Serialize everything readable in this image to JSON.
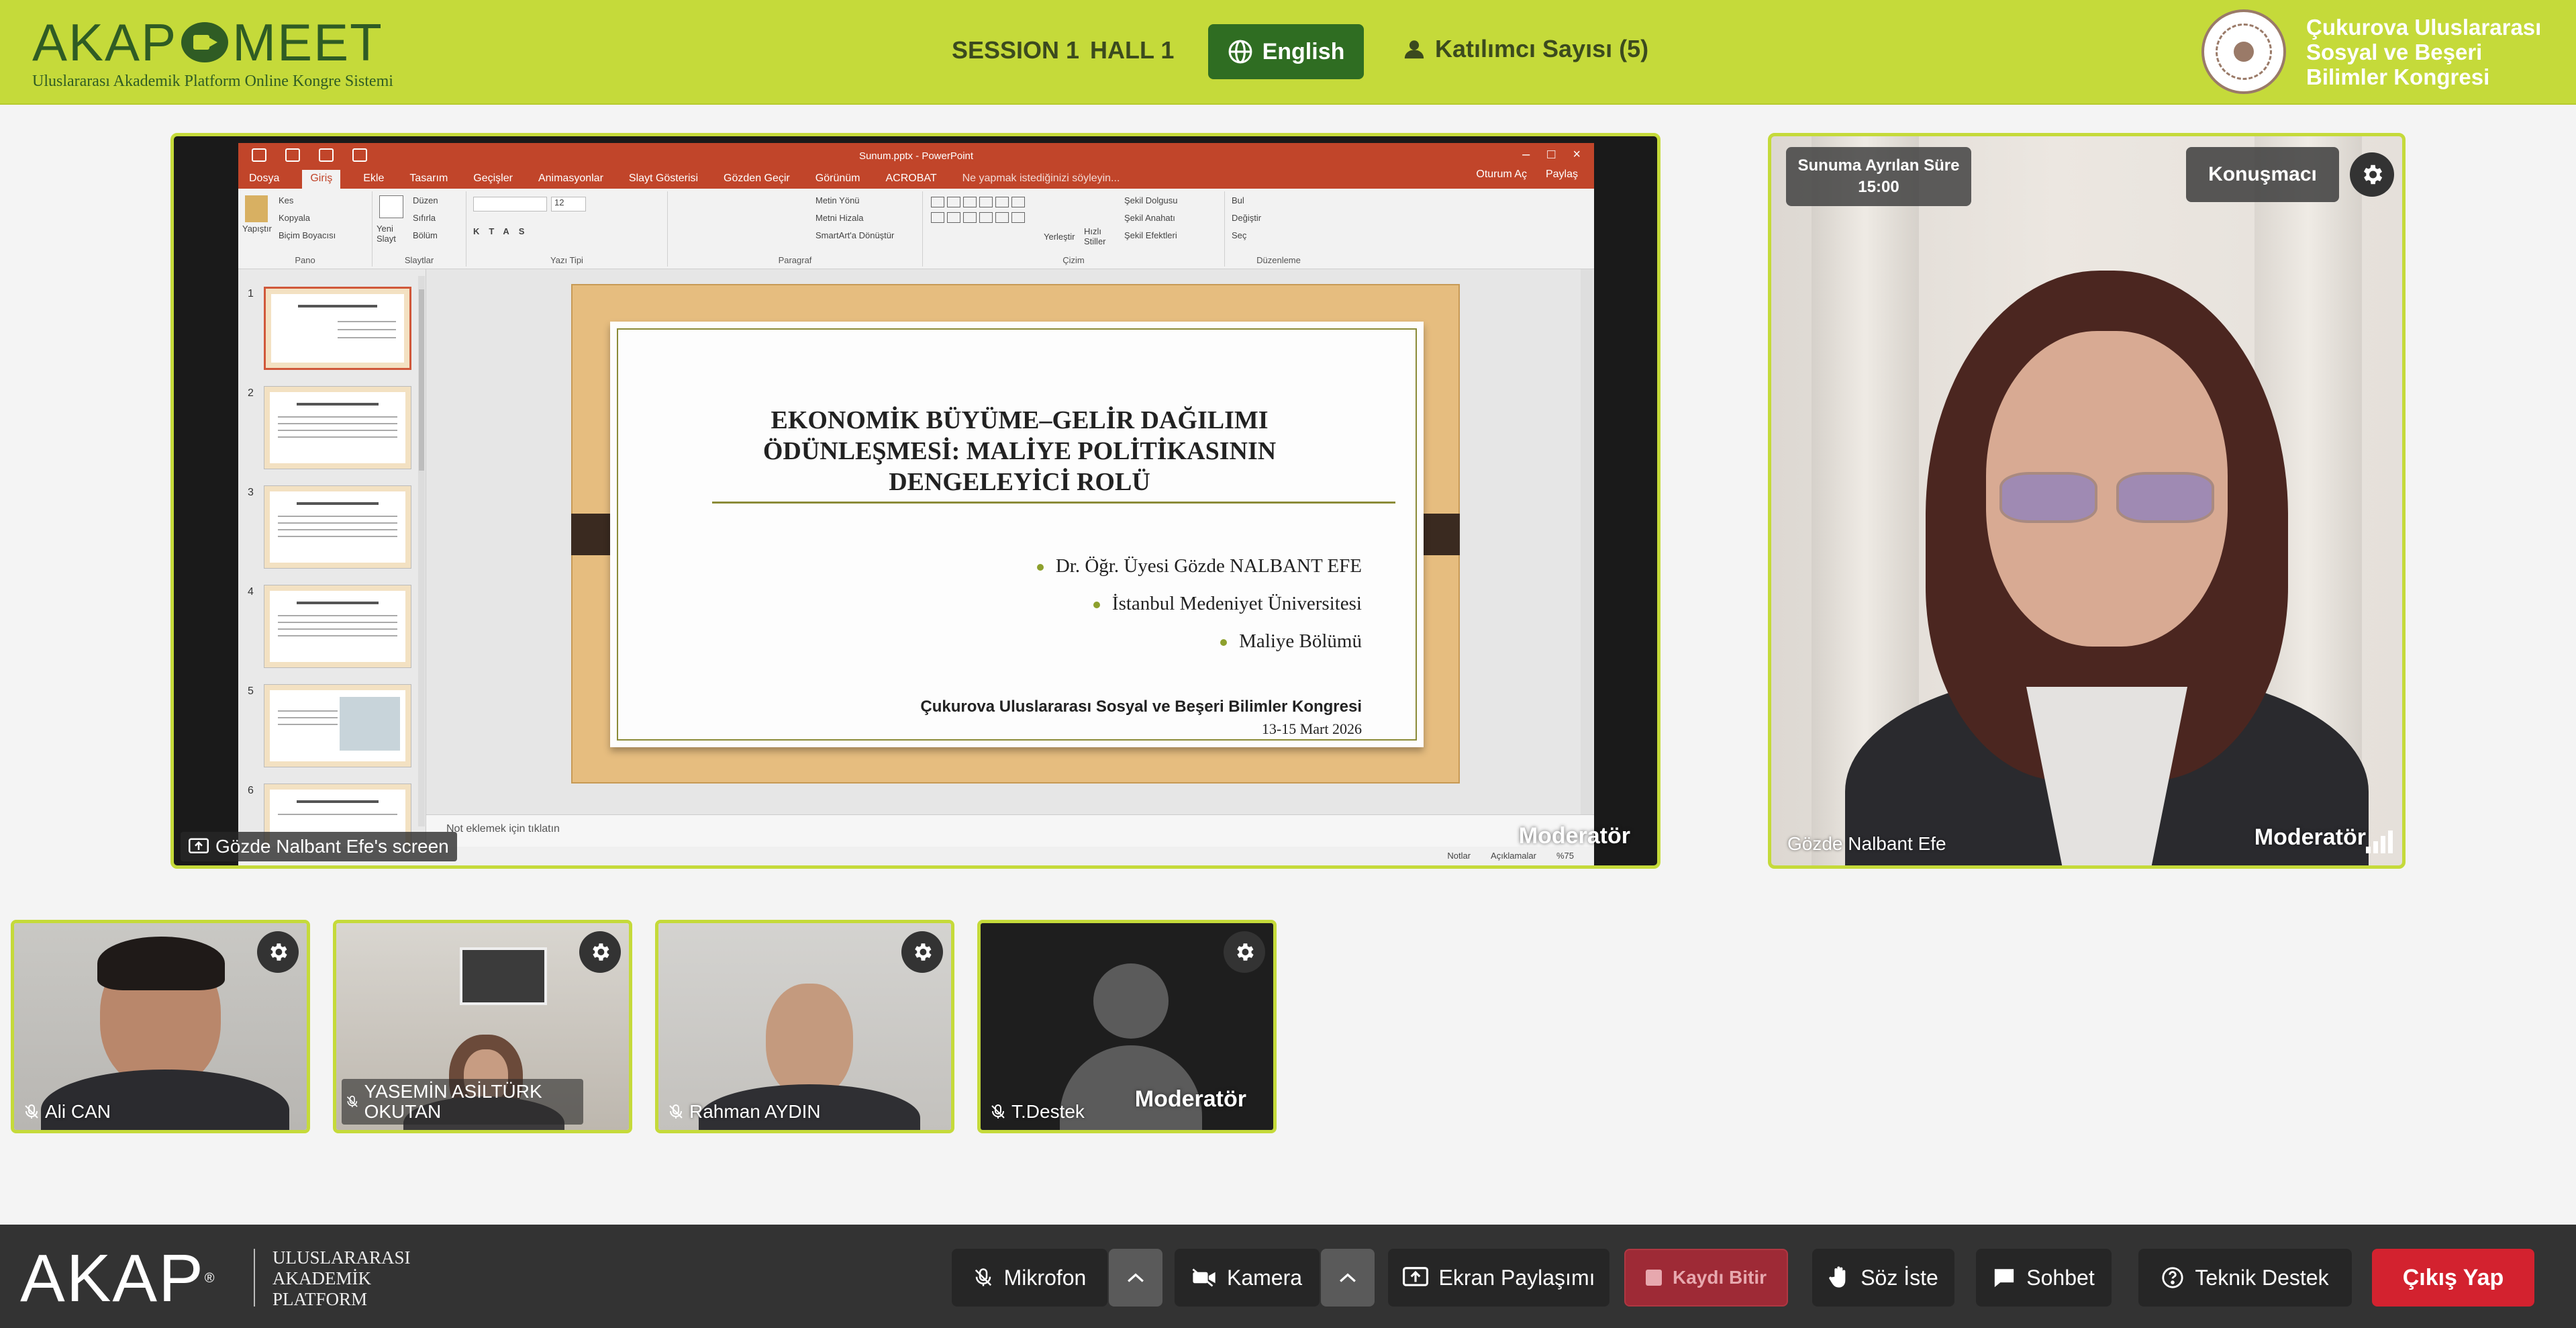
{
  "header": {
    "logo_main": "AKAP",
    "logo_main_suffix": "MEET",
    "logo_sub": "Uluslararası Akademik Platform Online Kongre Sistemi",
    "session": "SESSION 1",
    "hall": "HALL 1",
    "language_label": "English",
    "participants_label": "Katılımcı Sayısı (5)",
    "congress_title_l1": "Çukurova Uluslararası",
    "congress_title_l2": "Sosyal ve Beşeri",
    "congress_title_l3": "Bilimler Kongresi"
  },
  "share": {
    "window_title": "Sunum.pptx - PowerPoint",
    "tabs": [
      "Dosya",
      "Giriş",
      "Ekle",
      "Tasarım",
      "Geçişler",
      "Animasyonlar",
      "Slayt Gösterisi",
      "Gözden Geçir",
      "Görünüm",
      "ACROBAT"
    ],
    "tell_me": "Ne yapmak istediğinizi söyleyin...",
    "tabs_right": [
      "Oturum Aç",
      "Paylaş"
    ],
    "ribbon_groups": [
      "Pano",
      "Slaytlar",
      "Yazı Tipi",
      "Paragraf",
      "Çizim",
      "Düzenleme"
    ],
    "ribbon_items": {
      "paste": "Yapıştır",
      "cut": "Kes",
      "copy": "Kopyala",
      "format_painter": "Biçim Boyacısı",
      "new_slide": "Yeni Slayt",
      "layout": "Düzen",
      "reset": "Sıfırla",
      "section": "Bölüm",
      "font_size": "12",
      "text_direction": "Metin Yönü",
      "align_text": "Metni Hizala",
      "smartart": "SmartArt'a Dönüştür",
      "arrange": "Yerleştir",
      "quick_styles": "Hızlı Stiller",
      "shape_fill": "Şekil Dolgusu",
      "shape_outline": "Şekil Anahatı",
      "shape_effects": "Şekil Efektleri",
      "find": "Bul",
      "replace": "Değiştir",
      "select": "Seç"
    },
    "thumb_numbers": [
      "1",
      "2",
      "3",
      "4",
      "5",
      "6"
    ],
    "thumb_titles": [
      "",
      "Giriş Yönlem",
      "Araştırma Yöntem",
      "Çalışmanın Teorik Arglamaları",
      "",
      "Önlemlerin Teminatının Ekonomik Düzenlikler"
    ],
    "slide": {
      "title_l1": "EKONOMİK BÜYÜME–GELİR DAĞILIMI",
      "title_l2": "ÖDÜNLEŞMESİ: MALİYE POLİTİKASININ",
      "title_l3": "DENGELEYİCİ ROLÜ",
      "bullets": [
        "Dr. Öğr. Üyesi Gözde NALBANT EFE",
        "İstanbul Medeniyet Üniversitesi",
        "Maliye Bölümü"
      ],
      "conference": "Çukurova Uluslararası Sosyal ve Beşeri Bilimler Kongresi",
      "date": "13-15 Mart 2026"
    },
    "notes_placeholder": "Not eklemek için tıklatın",
    "status_items": [
      "Notlar",
      "Açıklamalar",
      "%75"
    ],
    "screen_label": "Gözde Nalbant Efe's screen",
    "moderator_label": "Moderatör"
  },
  "speaker": {
    "time_label": "Sunuma Ayrılan Süre",
    "time_value": "15:00",
    "role_button": "Konuşmacı",
    "name": "Gözde Nalbant Efe",
    "moderator_label": "Moderatör"
  },
  "tiles": [
    {
      "name": "Ali CAN"
    },
    {
      "name": "YASEMİN ASİLTÜRK OKUTAN"
    },
    {
      "name": "Rahman AYDIN"
    },
    {
      "name": "T.Destek",
      "moderator_label": "Moderatör"
    }
  ],
  "bottombar": {
    "brand": "AKAP",
    "brand_sub_l1": "ULUSLARARASI",
    "brand_sub_l2": "AKADEMİK",
    "brand_sub_l3": "PLATFORM",
    "mic": "Mikrofon",
    "camera": "Kamera",
    "screen_share": "Ekran Paylaşımı",
    "stop_record": "Kaydı Bitir",
    "raise_hand": "Söz İste",
    "chat": "Sohbet",
    "support": "Teknik Destek",
    "exit": "Çıkış Yap"
  },
  "colors": {
    "brand_green": "#c5da3a",
    "dark_green": "#2f6d22",
    "bar_dark": "#333333",
    "exit_red": "#d3222f",
    "record_red": "#9e2a36"
  }
}
